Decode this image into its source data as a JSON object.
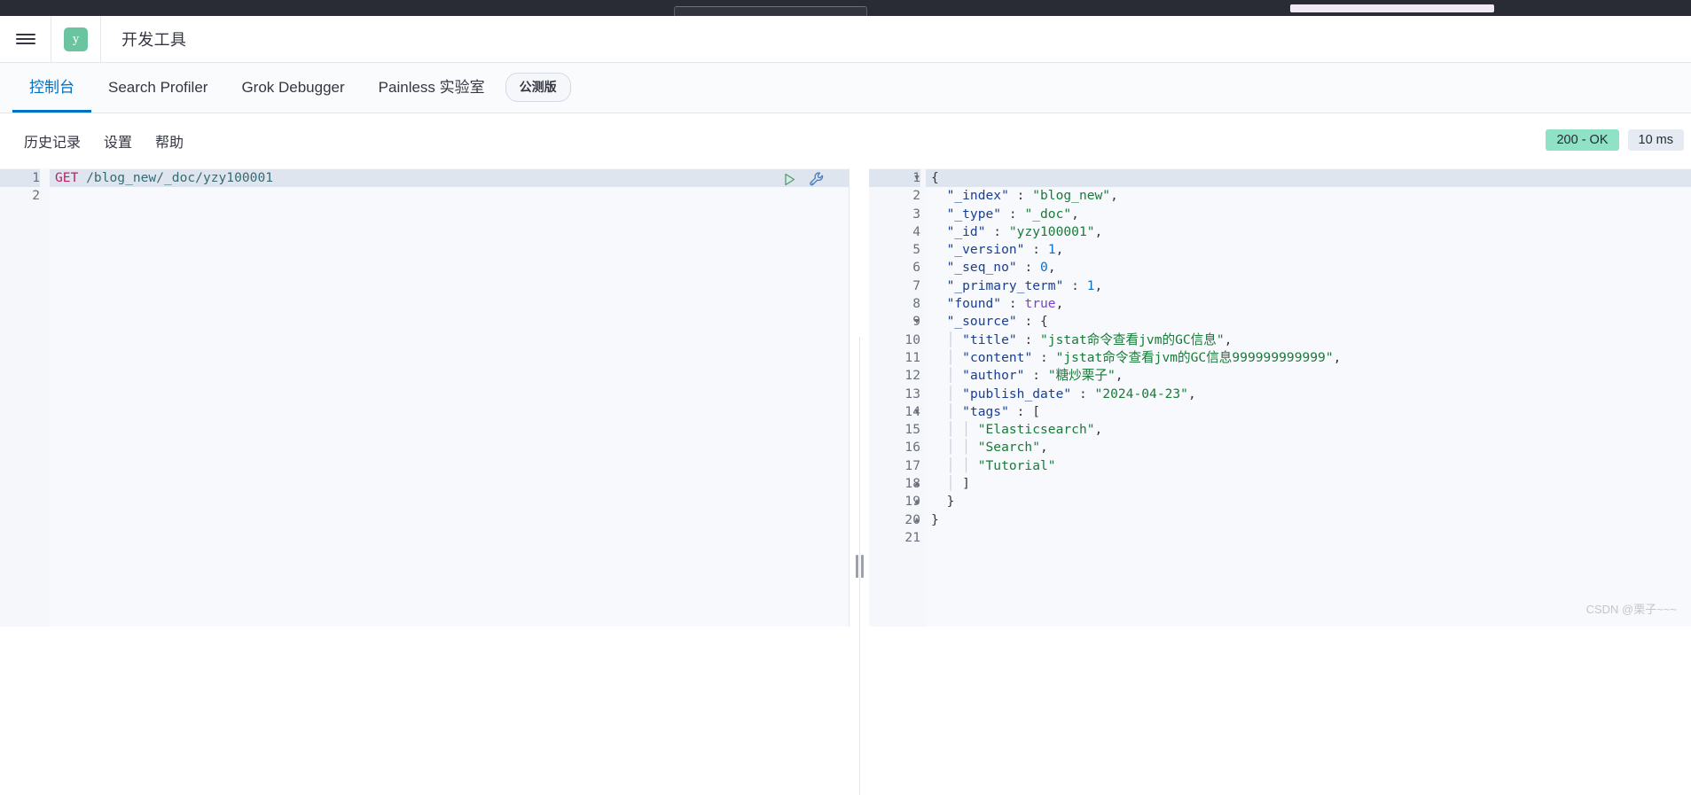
{
  "browser_chrome": {
    "visible": true
  },
  "header": {
    "menu_icon": "hamburger-icon",
    "logo_letter": "y",
    "title": "开发工具"
  },
  "tabs": [
    {
      "label": "控制台",
      "active": true
    },
    {
      "label": "Search Profiler",
      "active": false
    },
    {
      "label": "Grok Debugger",
      "active": false
    },
    {
      "label": "Painless 实验室",
      "active": false
    }
  ],
  "beta_badge": "公测版",
  "subbar": {
    "items": [
      "历史记录",
      "设置",
      "帮助"
    ],
    "status": "200 - OK",
    "time": "10 ms",
    "status_color": "#8fe2c5",
    "time_color": "#e6eaf2"
  },
  "request_editor": {
    "line_numbers": [
      "1",
      "2"
    ],
    "method": "GET",
    "path": "/blog_new/_doc/yzy100001",
    "play_icon": "play-icon",
    "wrench_icon": "wrench-icon"
  },
  "response_editor": {
    "line_numbers": [
      "1",
      "2",
      "3",
      "4",
      "5",
      "6",
      "7",
      "8",
      "9",
      "10",
      "11",
      "12",
      "13",
      "14",
      "15",
      "16",
      "17",
      "18",
      "19",
      "20",
      "21"
    ],
    "folds": {
      "1": "down",
      "9": "down",
      "14": "down",
      "18": "up",
      "19": "up",
      "20": "up"
    },
    "lines": [
      {
        "n": 1,
        "tokens": [
          {
            "t": "punct",
            "v": "{"
          }
        ]
      },
      {
        "n": 2,
        "tokens": [
          {
            "t": "plain",
            "v": "  "
          },
          {
            "t": "key",
            "v": "\"_index\""
          },
          {
            "t": "punct",
            "v": " : "
          },
          {
            "t": "str",
            "v": "\"blog_new\""
          },
          {
            "t": "punct",
            "v": ","
          }
        ]
      },
      {
        "n": 3,
        "tokens": [
          {
            "t": "plain",
            "v": "  "
          },
          {
            "t": "key",
            "v": "\"_type\""
          },
          {
            "t": "punct",
            "v": " : "
          },
          {
            "t": "str",
            "v": "\"_doc\""
          },
          {
            "t": "punct",
            "v": ","
          }
        ]
      },
      {
        "n": 4,
        "tokens": [
          {
            "t": "plain",
            "v": "  "
          },
          {
            "t": "key",
            "v": "\"_id\""
          },
          {
            "t": "punct",
            "v": " : "
          },
          {
            "t": "str",
            "v": "\"yzy100001\""
          },
          {
            "t": "punct",
            "v": ","
          }
        ]
      },
      {
        "n": 5,
        "tokens": [
          {
            "t": "plain",
            "v": "  "
          },
          {
            "t": "key",
            "v": "\"_version\""
          },
          {
            "t": "punct",
            "v": " : "
          },
          {
            "t": "num",
            "v": "1"
          },
          {
            "t": "punct",
            "v": ","
          }
        ]
      },
      {
        "n": 6,
        "tokens": [
          {
            "t": "plain",
            "v": "  "
          },
          {
            "t": "key",
            "v": "\"_seq_no\""
          },
          {
            "t": "punct",
            "v": " : "
          },
          {
            "t": "num",
            "v": "0"
          },
          {
            "t": "punct",
            "v": ","
          }
        ]
      },
      {
        "n": 7,
        "tokens": [
          {
            "t": "plain",
            "v": "  "
          },
          {
            "t": "key",
            "v": "\"_primary_term\""
          },
          {
            "t": "punct",
            "v": " : "
          },
          {
            "t": "num",
            "v": "1"
          },
          {
            "t": "punct",
            "v": ","
          }
        ]
      },
      {
        "n": 8,
        "tokens": [
          {
            "t": "plain",
            "v": "  "
          },
          {
            "t": "key",
            "v": "\"found\""
          },
          {
            "t": "punct",
            "v": " : "
          },
          {
            "t": "bool",
            "v": "true"
          },
          {
            "t": "punct",
            "v": ","
          }
        ]
      },
      {
        "n": 9,
        "tokens": [
          {
            "t": "plain",
            "v": "  "
          },
          {
            "t": "key",
            "v": "\"_source\""
          },
          {
            "t": "punct",
            "v": " : "
          },
          {
            "t": "punct",
            "v": "{"
          }
        ]
      },
      {
        "n": 10,
        "tokens": [
          {
            "t": "guide",
            "v": "  │ "
          },
          {
            "t": "key",
            "v": "\"title\""
          },
          {
            "t": "punct",
            "v": " : "
          },
          {
            "t": "str",
            "v": "\"jstat命令查看jvm的GC信息\""
          },
          {
            "t": "punct",
            "v": ","
          }
        ]
      },
      {
        "n": 11,
        "tokens": [
          {
            "t": "guide",
            "v": "  │ "
          },
          {
            "t": "key",
            "v": "\"content\""
          },
          {
            "t": "punct",
            "v": " : "
          },
          {
            "t": "str",
            "v": "\"jstat命令查看jvm的GC信息999999999999\""
          },
          {
            "t": "punct",
            "v": ","
          }
        ]
      },
      {
        "n": 12,
        "tokens": [
          {
            "t": "guide",
            "v": "  │ "
          },
          {
            "t": "key",
            "v": "\"author\""
          },
          {
            "t": "punct",
            "v": " : "
          },
          {
            "t": "str",
            "v": "\"糖炒栗子\""
          },
          {
            "t": "punct",
            "v": ","
          }
        ]
      },
      {
        "n": 13,
        "tokens": [
          {
            "t": "guide",
            "v": "  │ "
          },
          {
            "t": "key",
            "v": "\"publish_date\""
          },
          {
            "t": "punct",
            "v": " : "
          },
          {
            "t": "str",
            "v": "\"2024-04-23\""
          },
          {
            "t": "punct",
            "v": ","
          }
        ]
      },
      {
        "n": 14,
        "tokens": [
          {
            "t": "guide",
            "v": "  │ "
          },
          {
            "t": "key",
            "v": "\"tags\""
          },
          {
            "t": "punct",
            "v": " : "
          },
          {
            "t": "punct",
            "v": "["
          }
        ]
      },
      {
        "n": 15,
        "tokens": [
          {
            "t": "guide",
            "v": "  │ │ "
          },
          {
            "t": "str",
            "v": "\"Elasticsearch\""
          },
          {
            "t": "punct",
            "v": ","
          }
        ]
      },
      {
        "n": 16,
        "tokens": [
          {
            "t": "guide",
            "v": "  │ │ "
          },
          {
            "t": "str",
            "v": "\"Search\""
          },
          {
            "t": "punct",
            "v": ","
          }
        ]
      },
      {
        "n": 17,
        "tokens": [
          {
            "t": "guide",
            "v": "  │ │ "
          },
          {
            "t": "str",
            "v": "\"Tutorial\""
          }
        ]
      },
      {
        "n": 18,
        "tokens": [
          {
            "t": "guide",
            "v": "  │ "
          },
          {
            "t": "punct",
            "v": "]"
          }
        ]
      },
      {
        "n": 19,
        "tokens": [
          {
            "t": "plain",
            "v": "  "
          },
          {
            "t": "punct",
            "v": "}"
          }
        ]
      },
      {
        "n": 20,
        "tokens": [
          {
            "t": "punct",
            "v": "}"
          }
        ]
      },
      {
        "n": 21,
        "tokens": []
      }
    ]
  },
  "watermark": "CSDN @栗子~~~"
}
